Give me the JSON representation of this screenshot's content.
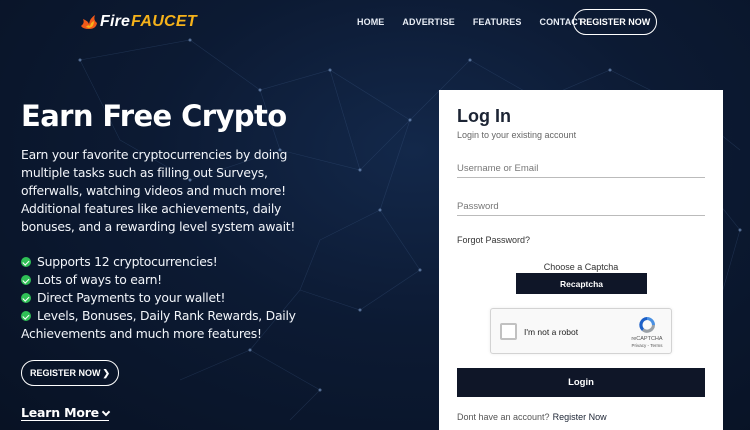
{
  "header": {
    "logo_fire": "Fire",
    "logo_faucet": "FAUCET",
    "nav": [
      "HOME",
      "ADVERTISE",
      "FEATURES",
      "CONTACT"
    ],
    "register_label": "REGISTER NOW"
  },
  "hero": {
    "title": "Earn Free Crypto",
    "description": "Earn your favorite cryptocurrencies by doing multiple tasks such as filling out Surveys, offerwalls, watching videos and much more! Additional features like achievements, daily bonuses, and a rewarding level system await!",
    "features": [
      "Supports 12 cryptocurrencies!",
      "Lots of ways to earn!",
      "Direct Payments to your wallet!",
      "Levels, Bonuses, Daily Rank Rewards, Daily Achievements and much more features!"
    ],
    "register_label": "REGISTER NOW",
    "learn_more": "Learn More"
  },
  "login": {
    "title": "Log In",
    "subtitle": "Login to your existing account",
    "username_placeholder": "Username or Email",
    "password_placeholder": "Password",
    "forgot_label": "Forgot Password?",
    "captcha_label": "Choose a Captcha",
    "captcha_selected": "Recaptcha",
    "recaptcha_text": "I'm not a robot",
    "recaptcha_brand": "reCAPTCHA",
    "recaptcha_terms": "Privacy - Terms",
    "login_button": "Login",
    "signup_text": "Dont have an account?",
    "signup_link": "Register Now"
  },
  "colors": {
    "background": "#0c1a33",
    "accent_orange": "#f6b21a",
    "check_green": "#2fbf56",
    "button_dark": "#0f1628"
  },
  "icons": [
    "flame-icon",
    "check-icon",
    "chevron-right-icon",
    "chevron-down-icon",
    "recaptcha-icon"
  ]
}
